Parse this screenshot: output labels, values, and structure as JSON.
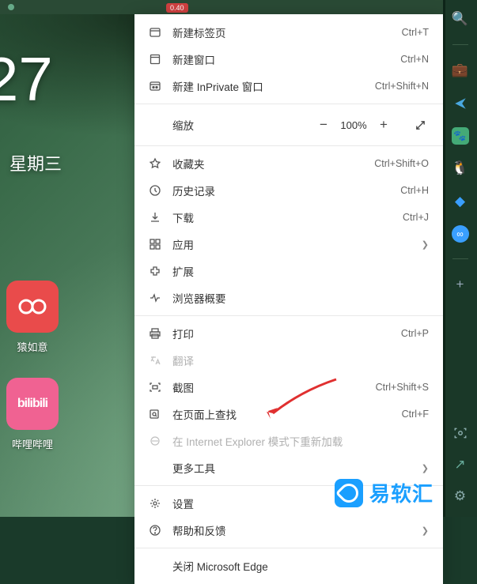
{
  "topbar": {
    "badge": "0.40"
  },
  "clock": "27",
  "weekday": "星期三",
  "tiles": [
    {
      "label": "猿如意",
      "style": "red",
      "glyph": "෧"
    },
    {
      "label": "哔哩哔哩",
      "style": "pink",
      "glyph": "bilibili"
    }
  ],
  "menu": {
    "new_tab": {
      "label": "新建标签页",
      "shortcut": "Ctrl+T"
    },
    "new_window": {
      "label": "新建窗口",
      "shortcut": "Ctrl+N"
    },
    "new_inprivate": {
      "label": "新建 InPrivate 窗口",
      "shortcut": "Ctrl+Shift+N"
    },
    "zoom": {
      "label": "缩放",
      "value": "100%"
    },
    "favorites": {
      "label": "收藏夹",
      "shortcut": "Ctrl+Shift+O"
    },
    "history": {
      "label": "历史记录",
      "shortcut": "Ctrl+H"
    },
    "downloads": {
      "label": "下载",
      "shortcut": "Ctrl+J"
    },
    "apps": {
      "label": "应用"
    },
    "extensions": {
      "label": "扩展"
    },
    "perf": {
      "label": "浏览器概要"
    },
    "print": {
      "label": "打印",
      "shortcut": "Ctrl+P"
    },
    "translate": {
      "label": "翻译"
    },
    "screenshot": {
      "label": "截图",
      "shortcut": "Ctrl+Shift+S"
    },
    "find": {
      "label": "在页面上查找",
      "shortcut": "Ctrl+F"
    },
    "ie_mode": {
      "label": "在 Internet Explorer 模式下重新加载"
    },
    "more_tools": {
      "label": "更多工具"
    },
    "settings": {
      "label": "设置"
    },
    "help": {
      "label": "帮助和反馈"
    },
    "close": {
      "label": "关闭 Microsoft Edge"
    }
  },
  "watermark": "易软汇"
}
